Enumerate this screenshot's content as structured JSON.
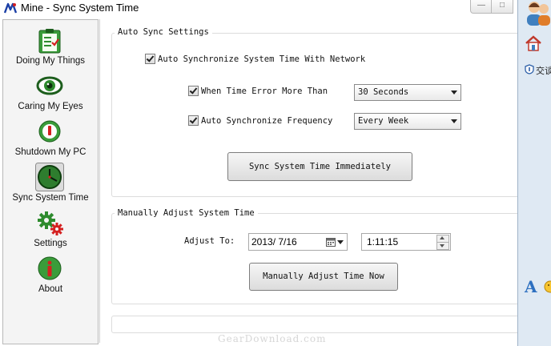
{
  "window": {
    "title": "Mine - Sync System Time"
  },
  "sidebar": {
    "items": [
      {
        "label": "Doing My Things",
        "icon": "clipboard-checklist-icon"
      },
      {
        "label": "Caring My Eyes",
        "icon": "eye-icon"
      },
      {
        "label": "Shutdown My PC",
        "icon": "power-icon"
      },
      {
        "label": "Sync System Time",
        "icon": "clock-icon",
        "selected": true
      },
      {
        "label": "Settings",
        "icon": "gears-icon"
      },
      {
        "label": "About",
        "icon": "info-icon"
      }
    ]
  },
  "auto_sync": {
    "legend": "Auto Sync Settings",
    "auto_sync_label": "Auto Synchronize System Time With Network",
    "auto_sync_checked": true,
    "time_error_label": "When Time Error More Than",
    "time_error_checked": true,
    "time_error_value": "30 Seconds",
    "frequency_label": "Auto Synchronize Frequency",
    "frequency_checked": true,
    "frequency_value": "Every Week",
    "sync_button": "Sync System Time Immediately"
  },
  "manual": {
    "legend": "Manually Adjust System Time",
    "adjust_label": "Adjust To:",
    "date_value": "2013/ 7/16",
    "time_value": "1:11:15",
    "adjust_button": "Manually Adjust Time Now"
  },
  "right_panel": {
    "text_fragment": "交谈"
  },
  "watermark": "GearDownload.com",
  "colors": {
    "accent_green": "#2e8b2e",
    "accent_red": "#d42020",
    "selected_bg": "#dcdcdc"
  }
}
